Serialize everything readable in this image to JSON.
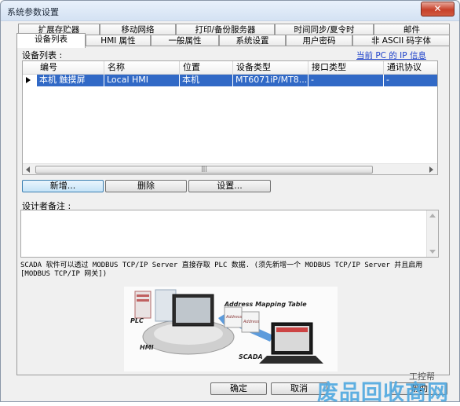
{
  "window": {
    "title": "系统参数设置",
    "close_label": "✕"
  },
  "tabs_row1": [
    {
      "label": "扩展存贮器"
    },
    {
      "label": "移动网络"
    },
    {
      "label": "打印/备份服务器"
    },
    {
      "label": "时间同步/夏令时"
    },
    {
      "label": "邮件"
    }
  ],
  "tabs_row2": [
    {
      "label": "设备列表"
    },
    {
      "label": "HMI 属性"
    },
    {
      "label": "一般属性"
    },
    {
      "label": "系统设置"
    },
    {
      "label": "用户密码"
    },
    {
      "label": "非 ASCII 码字体"
    }
  ],
  "device_list": {
    "label": "设备列表 :",
    "pc_ip_link": "当前 PC 的 IP 信息",
    "columns": [
      "编号",
      "名称",
      "位置",
      "设备类型",
      "接口类型",
      "通讯协议"
    ],
    "rows": [
      [
        "本机 触摸屏",
        "Local HMI",
        "本机",
        "MT6071iP/MT8...",
        "-",
        "-"
      ]
    ],
    "scroll_thumb": "|||"
  },
  "buttons": {
    "add": "新增...",
    "delete": "删除",
    "settings": "设置..."
  },
  "notes_label": "设计者备注 :",
  "description": "SCADA 软件可以透过 MODBUS TCP/IP Server 直接存取 PLC 数据. (须先新增一个 MODBUS TCP/IP Server 并且启用 [MODBUS TCP/IP 网关])",
  "diagram": {
    "title": "Address Mapping Table",
    "plc": "PLC",
    "hmi": "HMI",
    "scada": "SCADA",
    "address": "Address",
    "address2": "Address"
  },
  "footer": {
    "ok": "确定",
    "cancel": "取消",
    "help": "帮助"
  },
  "watermark": {
    "text": "废品回收商网",
    "small": "工控帮"
  },
  "colors": {
    "selection": "#3169c6",
    "link": "#1a3ec9",
    "watermark": "#4fa8e0"
  }
}
